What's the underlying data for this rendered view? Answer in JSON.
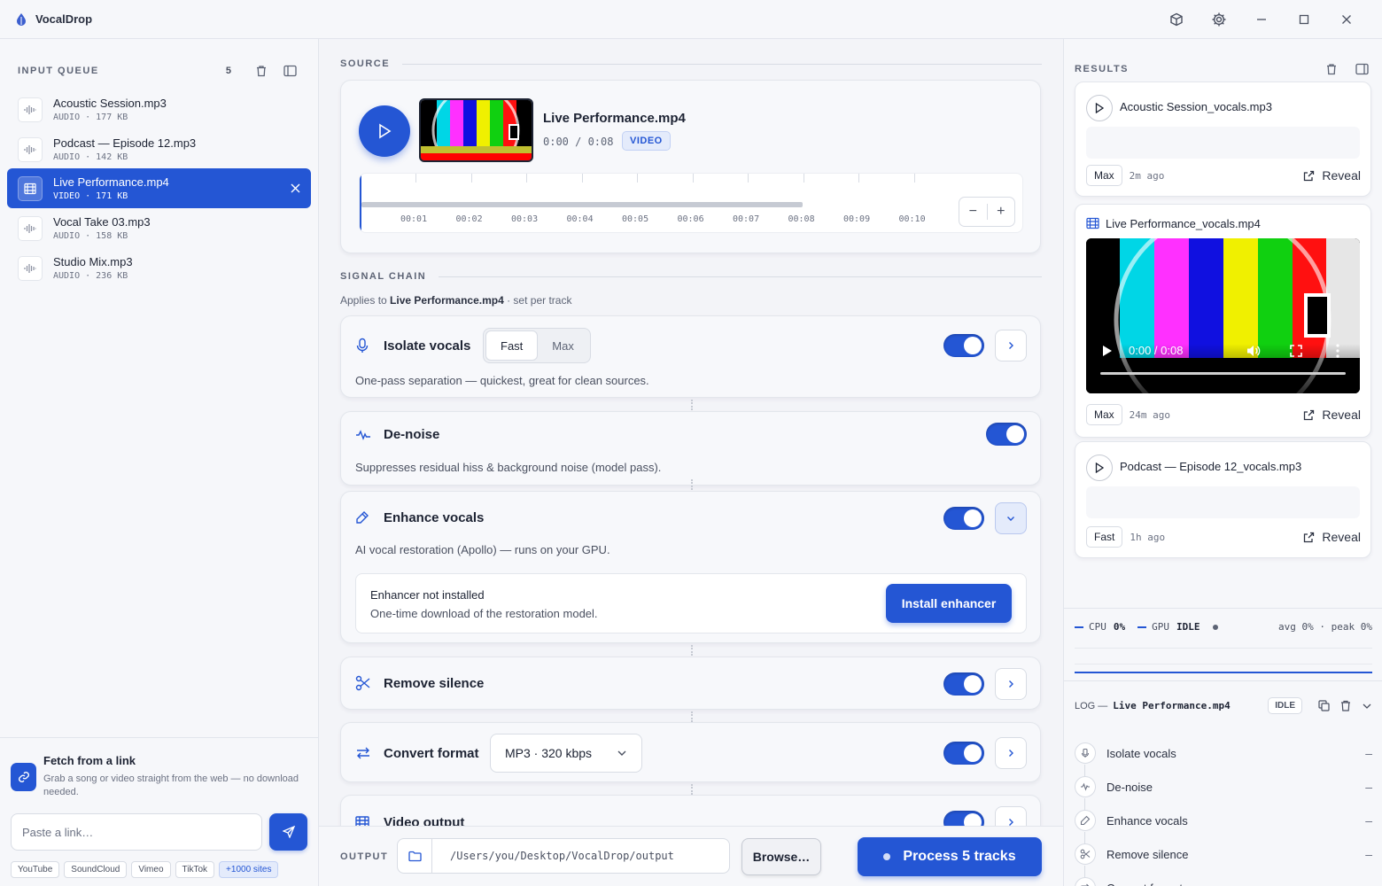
{
  "app": {
    "title": "VocalDrop"
  },
  "colors": {
    "accent": "#2456d4",
    "accent_soft": "#e4ebfb"
  },
  "left": {
    "queue_label": "INPUT QUEUE",
    "queue_count": "5",
    "items": [
      {
        "name": "Acoustic Session.mp3",
        "meta": "AUDIO · 177 KB",
        "icon": "waveform-icon"
      },
      {
        "name": "Podcast — Episode 12.mp3",
        "meta": "AUDIO · 142 KB",
        "icon": "waveform-icon"
      },
      {
        "name": "Live Performance.mp4",
        "meta": "VIDEO · 171 KB",
        "icon": "film-icon",
        "selected": true
      },
      {
        "name": "Vocal Take 03.mp3",
        "meta": "AUDIO · 158 KB",
        "icon": "waveform-icon"
      },
      {
        "name": "Studio Mix.mp3",
        "meta": "AUDIO · 236 KB",
        "icon": "waveform-icon"
      }
    ],
    "fetch": {
      "title": "Fetch from a link",
      "desc": "Grab a song or video straight from the web — no download needed.",
      "placeholder": "Paste a link…",
      "sites": [
        "YouTube",
        "SoundCloud",
        "Vimeo",
        "TikTok",
        "+1000 sites"
      ]
    }
  },
  "source": {
    "label": "SOURCE",
    "file": "Live Performance.mp4",
    "time": "0:00 / 0:08",
    "badge": "VIDEO",
    "timeline_labels": [
      "00:01",
      "00:02",
      "00:03",
      "00:04",
      "00:05",
      "00:06",
      "00:07",
      "00:08",
      "00:09",
      "00:10"
    ]
  },
  "chain": {
    "label": "SIGNAL CHAIN",
    "applies_prefix": "Applies to ",
    "applies_file": "Live Performance.mp4",
    "applies_suffix": " · set per track",
    "isolate": {
      "title": "Isolate vocals",
      "mode_fast": "Fast",
      "mode_max": "Max",
      "selected": "Fast",
      "desc": "One-pass separation — quickest, great for clean sources.",
      "enabled": true
    },
    "denoise": {
      "title": "De-noise",
      "desc": "Suppresses residual hiss & background noise (model pass).",
      "enabled": true
    },
    "enhance": {
      "title": "Enhance vocals",
      "desc": "AI vocal restoration (Apollo) — runs on your GPU.",
      "enabled": true,
      "notice_title": "Enhancer not installed",
      "notice_desc": "One-time download of the restoration model.",
      "install_label": "Install enhancer"
    },
    "silence": {
      "title": "Remove silence",
      "enabled": true
    },
    "convert": {
      "title": "Convert format",
      "format": "MP3 · 320 kbps",
      "enabled": true
    },
    "video_out": {
      "title": "Video output",
      "enabled": true
    }
  },
  "output": {
    "label": "OUTPUT",
    "path": "/Users/you/Desktop/VocalDrop/output",
    "browse_label": "Browse…",
    "process_label": "Process 5 tracks"
  },
  "results": {
    "label": "RESULTS",
    "items": [
      {
        "name": "Acoustic Session_vocals.mp3",
        "quality": "Max",
        "ago": "2m ago",
        "reveal": "Reveal"
      },
      {
        "name": "Live Performance_vocals.mp4",
        "quality": "Max",
        "ago": "24m ago",
        "reveal": "Reveal",
        "video_time": "0:00 / 0:08"
      },
      {
        "name": "Podcast — Episode 12_vocals.mp3",
        "quality": "Fast",
        "ago": "1h ago",
        "reveal": "Reveal"
      }
    ]
  },
  "monitor": {
    "cpu_label": "CPU",
    "cpu_value": "0%",
    "gpu_label": "GPU",
    "gpu_value": "IDLE",
    "avg_peak": "avg 0% · peak 0%"
  },
  "log": {
    "label": "LOG —",
    "file": "Live Performance.mp4",
    "status": "IDLE",
    "steps": [
      {
        "name": "Isolate vocals",
        "icon": "mic-icon",
        "status": "–"
      },
      {
        "name": "De-noise",
        "icon": "pulse-icon",
        "status": "–"
      },
      {
        "name": "Enhance vocals",
        "icon": "wand-icon",
        "status": "–"
      },
      {
        "name": "Remove silence",
        "icon": "scissors-icon",
        "status": "–"
      },
      {
        "name": "Convert format",
        "icon": "swap-icon",
        "status": "–"
      }
    ]
  }
}
